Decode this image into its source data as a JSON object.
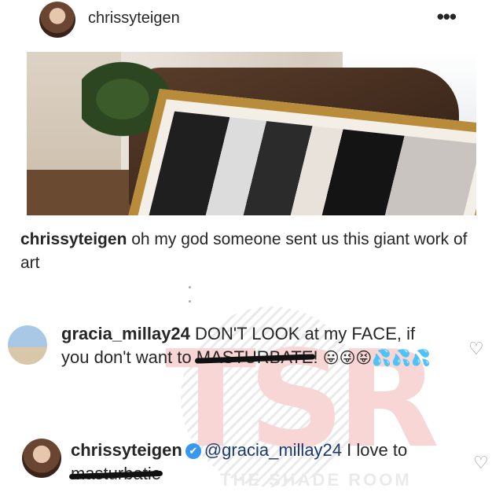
{
  "post": {
    "username": "chrissyteigen",
    "more_label": "•••"
  },
  "caption": {
    "username": "chrissyteigen",
    "text": " oh my god someone sent us this giant work of art"
  },
  "comments": [
    {
      "username": "gracia_millay24",
      "text_a": " DON'T LOOK at my FACE, if you don't want to ",
      "redacted": "MASTURBATE",
      "text_b": "! ",
      "emojis": "😛😜😝💦💦💦",
      "heart": "♡"
    },
    {
      "username": "chrissyteigen",
      "verified": "✔",
      "mention": "@gracia_millay24",
      "text_a": " I love to ",
      "redacted": "masturbatie",
      "heart": "♡"
    }
  ],
  "watermark": {
    "letters": "TSR",
    "text": "THE SHADE ROOM"
  },
  "colors": {
    "verified": "#3897f0",
    "watermark_red": "#e23a3a",
    "text": "#262626"
  }
}
